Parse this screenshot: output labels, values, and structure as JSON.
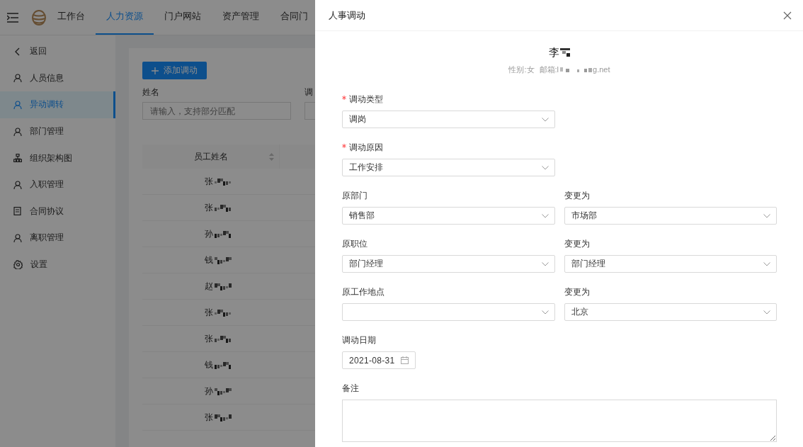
{
  "top_nav": {
    "tabs": [
      {
        "label": "工作台",
        "selected": false
      },
      {
        "label": "人力资源",
        "selected": true
      },
      {
        "label": "门户网站",
        "selected": false
      },
      {
        "label": "资产管理",
        "selected": false
      },
      {
        "label": "合同门",
        "selected": false
      }
    ]
  },
  "sidebar": {
    "items": [
      {
        "label": "返回",
        "kind": "back",
        "selected": false
      },
      {
        "label": "人员信息",
        "kind": "person",
        "selected": false
      },
      {
        "label": "异动调转",
        "kind": "person",
        "selected": true
      },
      {
        "label": "部门管理",
        "kind": "person",
        "selected": false
      },
      {
        "label": "组织架构图",
        "kind": "org",
        "selected": false
      },
      {
        "label": "入职管理",
        "kind": "person",
        "selected": false
      },
      {
        "label": "合同协议",
        "kind": "doc",
        "selected": false
      },
      {
        "label": "离职管理",
        "kind": "person",
        "selected": false
      },
      {
        "label": "设置",
        "kind": "gear",
        "selected": false
      }
    ]
  },
  "content": {
    "add_button": "添加调动",
    "filters": [
      {
        "label": "姓名",
        "placeholder": "请输入，支持部分匹配"
      },
      {
        "label": "调"
      }
    ],
    "table": {
      "columns": [
        "员工姓名"
      ],
      "rows": [
        {
          "name": "张"
        },
        {
          "name": "张"
        },
        {
          "name": "孙"
        },
        {
          "name": "钱"
        },
        {
          "name": "赵"
        },
        {
          "name": "张"
        },
        {
          "name": "张"
        },
        {
          "name": "钱"
        },
        {
          "name": "孙"
        },
        {
          "name": "张"
        }
      ]
    }
  },
  "drawer": {
    "title": "人事调动",
    "employee": {
      "name": "李",
      "gender": "性别:女",
      "email_start": "邮箱:l",
      "email_end": "g.net"
    },
    "rows": [
      {
        "fields": [
          {
            "label": "调动类型",
            "required": true,
            "kind": "select",
            "value": "调岗"
          }
        ]
      },
      {
        "fields": [
          {
            "label": "调动原因",
            "required": true,
            "kind": "select",
            "value": "工作安排"
          }
        ]
      },
      {
        "fields": [
          {
            "label": "原部门",
            "required": false,
            "kind": "select",
            "value": "销售部"
          },
          {
            "label": "变更为",
            "required": false,
            "kind": "select",
            "value": "市场部"
          }
        ]
      },
      {
        "fields": [
          {
            "label": "原职位",
            "required": false,
            "kind": "select",
            "value": "部门经理"
          },
          {
            "label": "变更为",
            "required": false,
            "kind": "select",
            "value": "部门经理"
          }
        ]
      },
      {
        "fields": [
          {
            "label": "原工作地点",
            "required": false,
            "kind": "select"
          },
          {
            "label": "变更为",
            "required": false,
            "kind": "select",
            "value": "北京"
          }
        ]
      },
      {
        "fields": [
          {
            "label": "调动日期",
            "required": false,
            "kind": "date",
            "value": "2021-08-31"
          }
        ]
      },
      {
        "fields": [
          {
            "label": "备注",
            "required": false,
            "kind": "textarea"
          }
        ]
      }
    ]
  }
}
